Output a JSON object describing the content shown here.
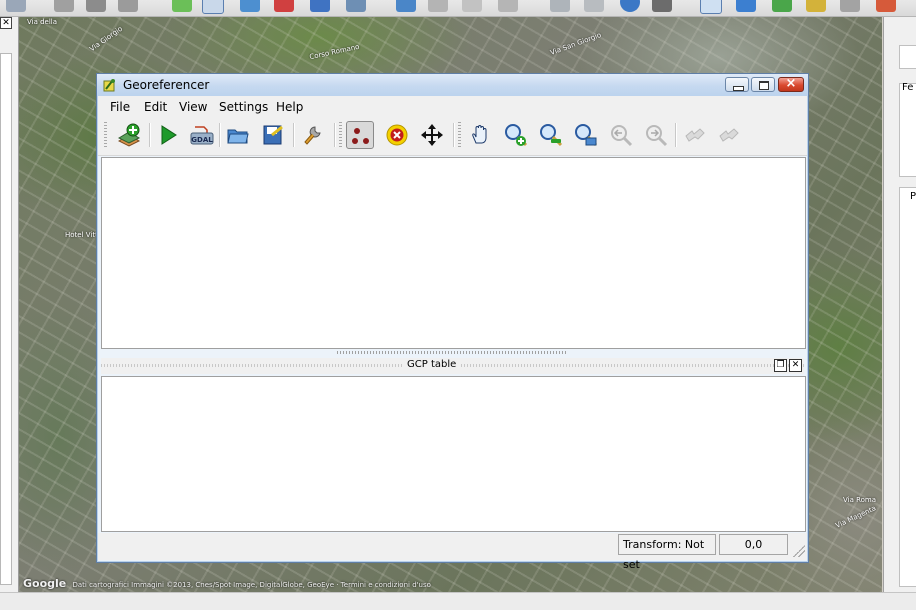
{
  "background_map": {
    "labels": [
      "Via della",
      "Corso Romano",
      "Via Giorgio",
      "Hotel Vittoriano",
      "Via San Giorgio",
      "Via Roma",
      "Via Magenta"
    ],
    "credits": {
      "logo": "Google",
      "text": "Dati cartografici Immagini ©2013, Cnes/Spot Image, DigitalGlobe, GeoEye · Termini e condizioni d'uso"
    },
    "left_panel_close": "✕",
    "right_panel_labels": [
      "Fe",
      "P"
    ]
  },
  "georeferencer": {
    "title": "Georeferencer",
    "menu": [
      "File",
      "Edit",
      "View",
      "Settings",
      "Help"
    ],
    "toolbar": {
      "open_raster": "open-raster",
      "start_georeferencing": "start-georeferencing",
      "generate_gdal_script": "generate-gdal-script",
      "gdal_label": "GDAL",
      "load_gcp_points": "load-gcp-points",
      "save_gcp_points": "save-gcp-points",
      "transformation_settings": "transformation-settings",
      "add_point": "add-point",
      "delete_point": "delete-point",
      "move_gcp_point": "move-gcp-point",
      "pan": "pan",
      "zoom_in": "zoom-in",
      "zoom_out": "zoom-out",
      "zoom_to_layer": "zoom-to-layer",
      "zoom_last": "zoom-last",
      "zoom_next": "zoom-next",
      "link_georeferencer_to_qgis": "link-georeferencer-to-qgis",
      "link_qgis_to_georeferencer": "link-qgis-to-georeferencer"
    },
    "gcp_table": {
      "title": "GCP table",
      "float_glyph": "❐",
      "close_glyph": "✕"
    },
    "status": {
      "transform": "Transform: Not set",
      "coords": "0,0"
    },
    "colors": {
      "title_gradient_top": "#dfeaf8",
      "close_red": "#d9492f",
      "accent_green": "#1e9a2a",
      "delete_yellow": "#f4d000"
    }
  }
}
